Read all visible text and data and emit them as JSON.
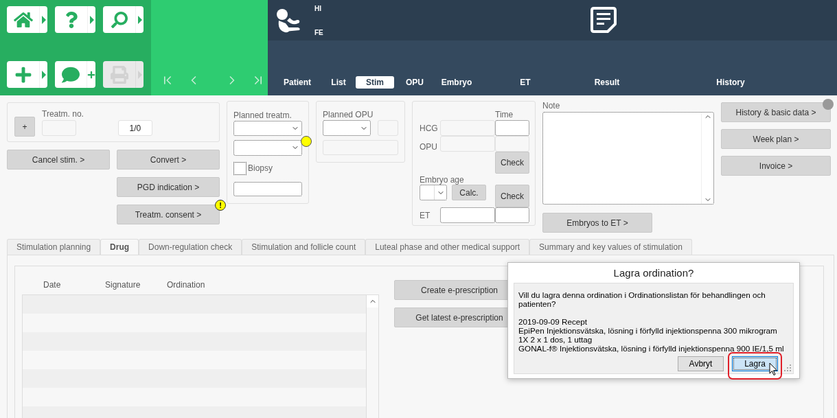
{
  "toolbar": {
    "buttons": [
      {
        "kind": "home",
        "disabled": false
      },
      {
        "kind": "help",
        "disabled": false
      },
      {
        "kind": "search",
        "disabled": false
      },
      {
        "kind": "add",
        "disabled": false
      },
      {
        "kind": "comment",
        "disabled": false
      },
      {
        "kind": "print",
        "disabled": true
      }
    ]
  },
  "patient": {
    "line_1": "HI",
    "line_2": "FE"
  },
  "nav_tabs": [
    {
      "label": "Patient",
      "selected": false
    },
    {
      "label": "List",
      "selected": false
    },
    {
      "label": "Stim",
      "selected": true
    },
    {
      "label": "OPU",
      "selected": false
    },
    {
      "label": "Embryo",
      "selected": false
    },
    {
      "label": "ET",
      "selected": false
    },
    {
      "label": "Result",
      "selected": false
    },
    {
      "label": "History",
      "selected": false
    }
  ],
  "treatment": {
    "add_button": "+",
    "label": "Treatm. no.",
    "count": "1/0"
  },
  "actions": [
    {
      "label": "Cancel stim. >"
    },
    {
      "label": "Convert >"
    },
    {
      "label": "PGD indication >"
    },
    {
      "label": "Treatm. consent >",
      "badge": "!"
    }
  ],
  "planned_treatment": {
    "label": "Planned treatm.",
    "flagged": true,
    "biopsy": {
      "label": "Biopsy",
      "checked": false
    }
  },
  "planned_opu": {
    "label": "Planned OPU"
  },
  "dates": {
    "time_label": "Time",
    "hcg_label": "HCG",
    "opu_label": "OPU",
    "check_buttons": [
      "Check",
      "Check"
    ],
    "embryo_age_label": "Embryo age",
    "calc_button": "Calc.",
    "et_label": "ET"
  },
  "note": {
    "label": "Note",
    "button": "Embryos to ET >"
  },
  "side_buttons": [
    "History & basic data >",
    "Week plan >",
    "Invoice >"
  ],
  "sub_tabs": [
    {
      "label": "Stimulation planning",
      "selected": false
    },
    {
      "label": "Drug",
      "selected": true
    },
    {
      "label": "Down-regulation check",
      "selected": false
    },
    {
      "label": "Stimulation and follicle count",
      "selected": false
    },
    {
      "label": "Luteal phase and other medical support",
      "selected": false
    },
    {
      "label": "Summary and key values of stimulation",
      "selected": false
    }
  ],
  "drug_table": {
    "columns": [
      "Date",
      "Signature",
      "Ordination"
    ]
  },
  "prescription_buttons": [
    "Create e-prescription",
    "Get latest e-prescription"
  ],
  "dialog": {
    "title": "Lagra ordination?",
    "message": "Vill du lagra denna ordination i Ordinationslistan för behandlingen och patienten?",
    "details": [
      "2019-09-09 Recept",
      "EpiPen Injektionsvätska, lösning i förfylld injektionspenna 300 mikrogram",
      "1X 2 x 1 dos, 1 uttag",
      "GONAL-f® Injektionsvätska, lösning i förfylld injektionspenna 900 IE/1,5 ml"
    ],
    "buttons": [
      {
        "label": "Avbryt",
        "default": false
      },
      {
        "label": "Lagra",
        "default": true
      }
    ]
  }
}
